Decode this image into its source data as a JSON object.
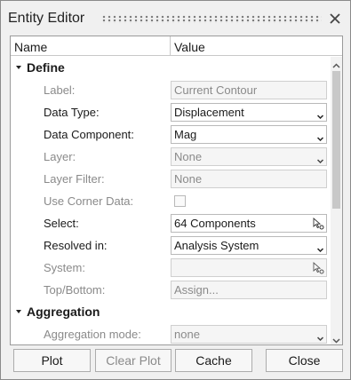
{
  "window": {
    "title": "Entity Editor"
  },
  "columns": {
    "name": "Name",
    "value": "Value"
  },
  "groups": {
    "define": "Define",
    "aggregation": "Aggregation"
  },
  "fields": {
    "label": {
      "name": "Label:",
      "value": "Current Contour"
    },
    "data_type": {
      "name": "Data Type:",
      "value": "Displacement"
    },
    "data_component": {
      "name": "Data Component:",
      "value": "Mag"
    },
    "layer": {
      "name": "Layer:",
      "value": "None"
    },
    "layer_filter": {
      "name": "Layer Filter:",
      "value": "None"
    },
    "use_corner_data": {
      "name": "Use Corner Data:",
      "checked": false
    },
    "select": {
      "name": "Select:",
      "value": "64 Components"
    },
    "resolved_in": {
      "name": "Resolved in:",
      "value": "Analysis System"
    },
    "system": {
      "name": "System:",
      "value": ""
    },
    "top_bottom": {
      "name": "Top/Bottom:",
      "value": "Assign..."
    },
    "aggregation_mode": {
      "name": "Aggregation mode:",
      "value": "none"
    }
  },
  "buttons": {
    "plot": "Plot",
    "clear_plot": "Clear Plot",
    "cache": "Cache",
    "close": "Close"
  }
}
